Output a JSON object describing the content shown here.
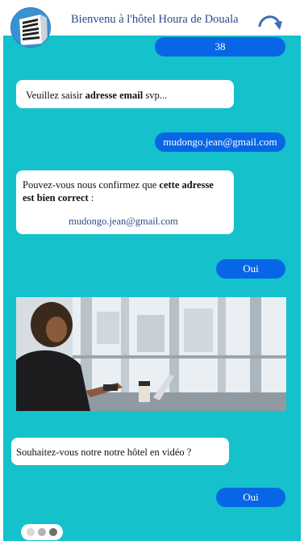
{
  "header": {
    "title": "Bienvenu à l'hôtel Houra de Douala",
    "logo_icon": "hotel-building-icon",
    "refresh_icon": "refresh-arrow-icon"
  },
  "messages": {
    "user_number": "38",
    "bot_email_prompt": {
      "prefix": "Veuillez saisir ",
      "bold": "adresse email",
      "suffix": " svp..."
    },
    "user_email": "mudongo.jean@gmail.com",
    "bot_confirm": {
      "prefix": "Pouvez-vous nous confirmez que ",
      "bold": "cette adresse est bien correct",
      "suffix": " :",
      "email": "mudongo.jean@gmail.com"
    },
    "user_yes_1": "Oui",
    "bot_video_question": "Souhaitez-vous notre notre hôtel en vidéo ?",
    "user_yes_2": "Oui"
  },
  "colors": {
    "chat_background": "#15c1cb",
    "user_bubble": "#0766e6",
    "bot_bubble": "#ffffff",
    "header_title": "#2c4a8a",
    "link_email": "#2c4a8a"
  },
  "typing_indicator": {
    "icon": "typing-dots-icon"
  }
}
